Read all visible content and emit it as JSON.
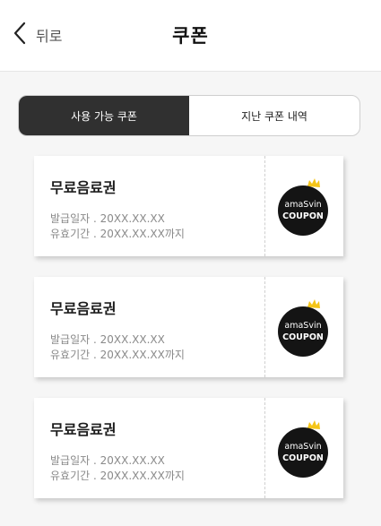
{
  "header": {
    "back_label": "뒤로",
    "title": "쿠폰"
  },
  "tabs": [
    {
      "label": "사용 가능 쿠폰",
      "active": true
    },
    {
      "label": "지난 쿠폰 내역",
      "active": false
    }
  ],
  "coupons": [
    {
      "title": "무료음료권",
      "issue_line": "발급일자 . 20XX.XX.XX",
      "valid_line": "유효기간 . 20XX.XX.XX까지",
      "badge_line1": "amaSvin",
      "badge_line2": "COUPON"
    },
    {
      "title": "무료음료권",
      "issue_line": "발급일자 . 20XX.XX.XX",
      "valid_line": "유효기간 . 20XX.XX.XX까지",
      "badge_line1": "amaSvin",
      "badge_line2": "COUPON"
    },
    {
      "title": "무료음료권",
      "issue_line": "발급일자 . 20XX.XX.XX",
      "valid_line": "유효기간 . 20XX.XX.XX까지",
      "badge_line1": "amaSvin",
      "badge_line2": "COUPON"
    }
  ],
  "colors": {
    "tab_active_bg": "#303030",
    "badge_bg": "#141414",
    "crown": "#f5c518"
  },
  "icons": {
    "back": "chevron-left-icon",
    "badge_crown": "crown-icon"
  }
}
